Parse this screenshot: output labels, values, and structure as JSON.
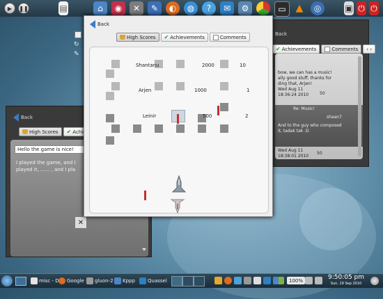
{
  "colors": {
    "accent": "#3a7bc8",
    "red_bar": "#c23030",
    "panel": "#243846"
  },
  "top_panel": {
    "icons": [
      "play-icon",
      "pause-icon",
      "document-icon",
      "file-manager-icon",
      "eye-icon",
      "tools-icon",
      "pen-icon",
      "firefox-icon",
      "globe-icon",
      "help-icon",
      "chat-icon",
      "settings-icon",
      "chrome-icon",
      "monitor-icon",
      "vlc-icon",
      "network-icon",
      "system-icon",
      "logout-icon",
      "power-icon"
    ]
  },
  "main_window": {
    "back_label": "Back",
    "tabs": [
      {
        "label": "High Scores",
        "icon": "trophy-icon",
        "active": true
      },
      {
        "label": "Achievements",
        "icon": "check-icon",
        "active": false
      },
      {
        "label": "Comments",
        "icon": "comment-icon",
        "active": false
      }
    ],
    "scores": [
      {
        "name": "Shantanu",
        "score": "2000",
        "rank": "10"
      },
      {
        "name": "Arjen",
        "score": "1000",
        "rank": "1"
      },
      {
        "name": "Leinir",
        "score": "500",
        "rank": "2"
      }
    ]
  },
  "left_window": {
    "back_label": "Back",
    "tabs": [
      {
        "label": "High Scores",
        "icon": "trophy-icon",
        "active": true
      },
      {
        "label": "Achie",
        "icon": "check-icon",
        "active": false
      }
    ],
    "comment_title": "Hello the game is nice!",
    "comment_lines": [
      "I played the game, and I",
      "played it, ...... , and I pla"
    ]
  },
  "right_window": {
    "back_label": "Back",
    "tabs": [
      {
        "label": "Achievements",
        "icon": "check-icon",
        "active": false
      },
      {
        "label": "Comments",
        "icon": "comment-icon",
        "active": true
      }
    ],
    "comments": [
      {
        "lines": [
          "bow, we can has a music!",
          "ally good stuff, thanks for",
          "ding that, Arjen!"
        ],
        "date": "Wed Aug 11",
        "time": "18:36:24 2010",
        "num": "50"
      },
      {
        "title": "Re: Music!",
        "user": "shaan7",
        "lines": [
          "And to the guy who composed",
          "it, tadak tak :D"
        ],
        "date": "Wed Aug 11",
        "time": "18:38:01 2010",
        "num": "50"
      }
    ]
  },
  "taskbar": {
    "tasks": [
      {
        "label": "misc - D",
        "icon": "terminal-icon"
      },
      {
        "label": "Google",
        "icon": "firefox-icon"
      },
      {
        "label": "gluon-2",
        "icon": "gluon-icon"
      },
      {
        "label": "Kppp",
        "icon": "kppp-icon"
      },
      {
        "label": "Quassel",
        "icon": "quassel-icon"
      }
    ],
    "zoom": "100%",
    "clock": "9:50:05 pm",
    "date": "Sun, 19 Sep 2010"
  }
}
